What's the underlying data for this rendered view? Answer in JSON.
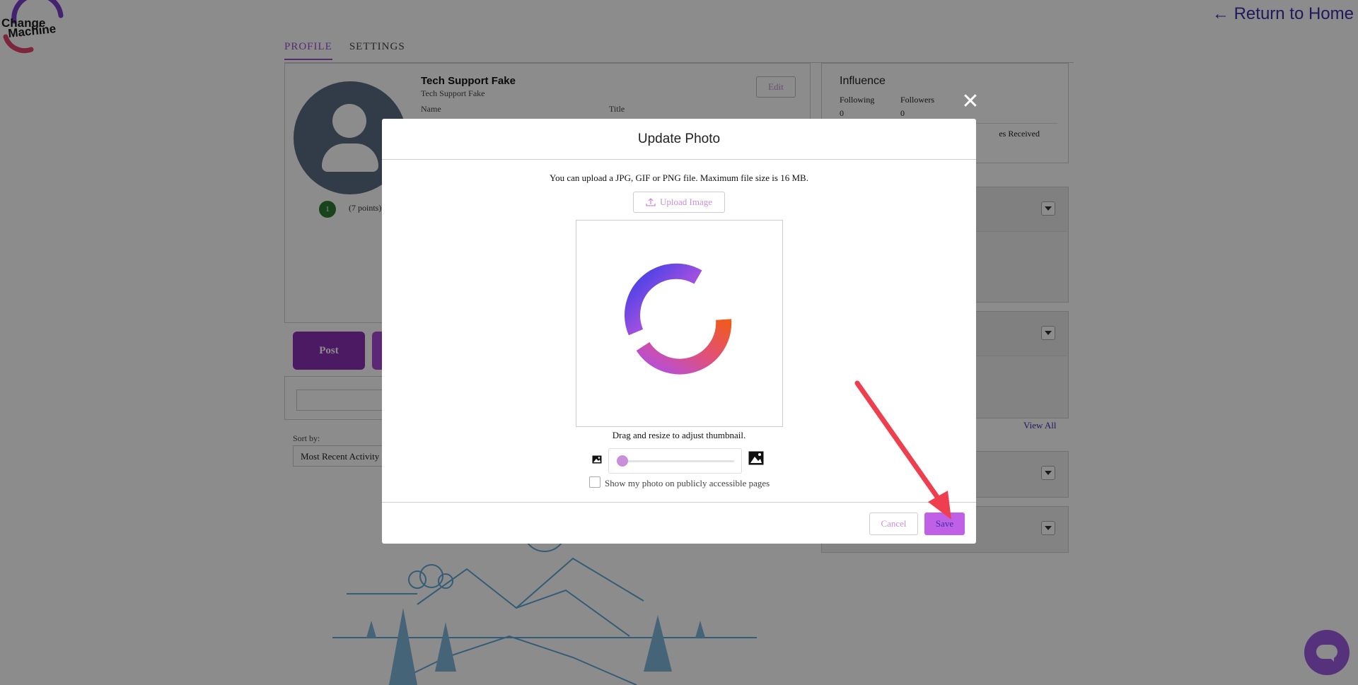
{
  "logo": {
    "line1": "Change",
    "line2": "Machine"
  },
  "header": {
    "return_home": "← Return to Home"
  },
  "tabs": [
    {
      "label": "PROFILE"
    },
    {
      "label": "SETTINGS"
    }
  ],
  "profile": {
    "name": "Tech Support Fake",
    "subname": "Tech Support Fake",
    "label_name": "Name",
    "label_title": "Title",
    "edit_label": "Edit",
    "badge": "1",
    "points": "(7 points)"
  },
  "post": {
    "label": "Post"
  },
  "sort": {
    "label": "Sort by:",
    "value": "Most Recent Activity"
  },
  "influence": {
    "title": "Influence",
    "following_label": "Following",
    "followers_label": "Followers",
    "following": "0",
    "followers": "0",
    "received_fragment": "es Received"
  },
  "side": {
    "view_all": "View All"
  },
  "modal": {
    "title": "Update Photo",
    "info": "You can upload a JPG, GIF or PNG file. Maximum file size is 16 MB.",
    "upload_label": "Upload Image",
    "drag_text": "Drag and resize to adjust thumbnail.",
    "zoom": 0.0,
    "public_label": "Show my photo on publicly accessible pages",
    "public_checked": false,
    "cancel_label": "Cancel",
    "save_label": "Save"
  },
  "colors": {
    "accent": "#9b4fcf",
    "primary_dark": "#8a2fb5",
    "save": "#c060e6",
    "link": "#3b2fa8",
    "arrow": "#ef3f4f"
  }
}
